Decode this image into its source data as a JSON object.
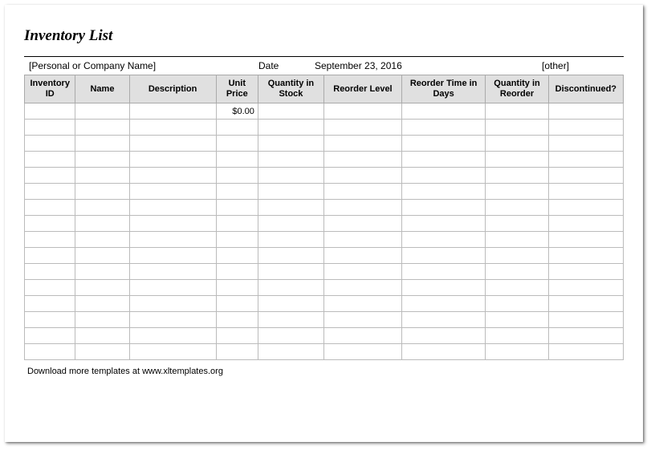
{
  "title": "Inventory List",
  "info": {
    "company_placeholder": "[Personal or Company Name]",
    "date_label": "Date",
    "date_value": "September 23, 2016",
    "other_placeholder": "[other]"
  },
  "columns": [
    "Inventory ID",
    "Name",
    "Description",
    "Unit Price",
    "Quantity in Stock",
    "Reorder Level",
    "Reorder Time in Days",
    "Quantity in Reorder",
    "Discontinued?"
  ],
  "rows": [
    {
      "id": "",
      "name": "",
      "desc": "",
      "price": "$0.00",
      "qstock": "",
      "reorder": "",
      "rtime": "",
      "qreorder": "",
      "disc": ""
    },
    {
      "id": "",
      "name": "",
      "desc": "",
      "price": "",
      "qstock": "",
      "reorder": "",
      "rtime": "",
      "qreorder": "",
      "disc": ""
    },
    {
      "id": "",
      "name": "",
      "desc": "",
      "price": "",
      "qstock": "",
      "reorder": "",
      "rtime": "",
      "qreorder": "",
      "disc": ""
    },
    {
      "id": "",
      "name": "",
      "desc": "",
      "price": "",
      "qstock": "",
      "reorder": "",
      "rtime": "",
      "qreorder": "",
      "disc": ""
    },
    {
      "id": "",
      "name": "",
      "desc": "",
      "price": "",
      "qstock": "",
      "reorder": "",
      "rtime": "",
      "qreorder": "",
      "disc": ""
    },
    {
      "id": "",
      "name": "",
      "desc": "",
      "price": "",
      "qstock": "",
      "reorder": "",
      "rtime": "",
      "qreorder": "",
      "disc": ""
    },
    {
      "id": "",
      "name": "",
      "desc": "",
      "price": "",
      "qstock": "",
      "reorder": "",
      "rtime": "",
      "qreorder": "",
      "disc": ""
    },
    {
      "id": "",
      "name": "",
      "desc": "",
      "price": "",
      "qstock": "",
      "reorder": "",
      "rtime": "",
      "qreorder": "",
      "disc": ""
    },
    {
      "id": "",
      "name": "",
      "desc": "",
      "price": "",
      "qstock": "",
      "reorder": "",
      "rtime": "",
      "qreorder": "",
      "disc": ""
    },
    {
      "id": "",
      "name": "",
      "desc": "",
      "price": "",
      "qstock": "",
      "reorder": "",
      "rtime": "",
      "qreorder": "",
      "disc": ""
    },
    {
      "id": "",
      "name": "",
      "desc": "",
      "price": "",
      "qstock": "",
      "reorder": "",
      "rtime": "",
      "qreorder": "",
      "disc": ""
    },
    {
      "id": "",
      "name": "",
      "desc": "",
      "price": "",
      "qstock": "",
      "reorder": "",
      "rtime": "",
      "qreorder": "",
      "disc": ""
    },
    {
      "id": "",
      "name": "",
      "desc": "",
      "price": "",
      "qstock": "",
      "reorder": "",
      "rtime": "",
      "qreorder": "",
      "disc": ""
    },
    {
      "id": "",
      "name": "",
      "desc": "",
      "price": "",
      "qstock": "",
      "reorder": "",
      "rtime": "",
      "qreorder": "",
      "disc": ""
    },
    {
      "id": "",
      "name": "",
      "desc": "",
      "price": "",
      "qstock": "",
      "reorder": "",
      "rtime": "",
      "qreorder": "",
      "disc": ""
    },
    {
      "id": "",
      "name": "",
      "desc": "",
      "price": "",
      "qstock": "",
      "reorder": "",
      "rtime": "",
      "qreorder": "",
      "disc": ""
    }
  ],
  "footer": "Download more templates at www.xltemplates.org"
}
